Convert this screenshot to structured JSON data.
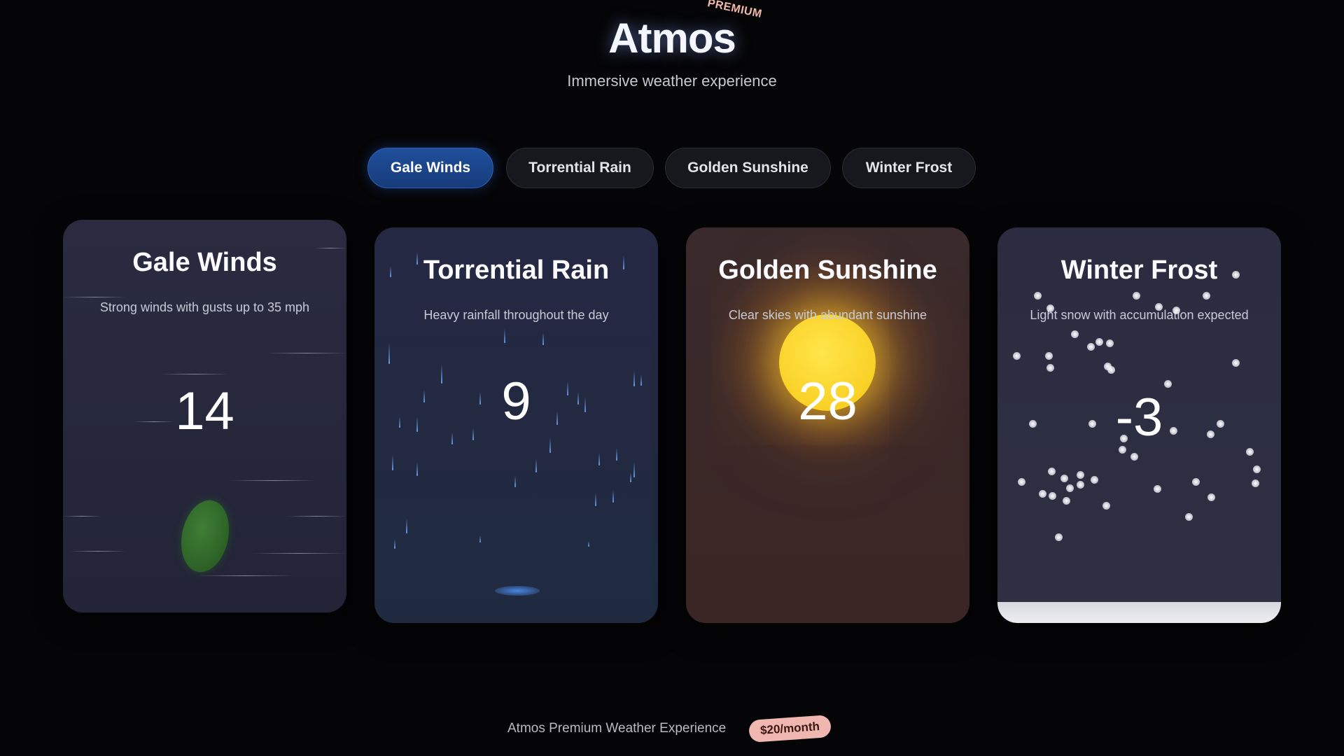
{
  "header": {
    "title": "Atmos",
    "premium_tag": "PREMIUM",
    "subtitle": "Immersive weather experience"
  },
  "tabs": [
    {
      "label": "Gale Winds",
      "active": true
    },
    {
      "label": "Torrential Rain",
      "active": false
    },
    {
      "label": "Golden Sunshine",
      "active": false
    },
    {
      "label": "Winter Frost",
      "active": false
    }
  ],
  "cards": {
    "wind": {
      "title": "Gale Winds",
      "description": "Strong winds with gusts up to 35 mph",
      "temperature": "14"
    },
    "rain": {
      "title": "Torrential Rain",
      "description": "Heavy rainfall throughout the day",
      "temperature": "9"
    },
    "sun": {
      "title": "Golden Sunshine",
      "description": "Clear skies with abundant sunshine",
      "temperature": "28"
    },
    "frost": {
      "title": "Winter Frost",
      "description": "Light snow with accumulation expected",
      "temperature": "-3"
    }
  },
  "footer": {
    "text": "Atmos Premium Weather Experience",
    "price": "$20/month"
  },
  "colors": {
    "background": "#050507",
    "active_tab": "#1f4f9c",
    "sun": "#ffe54a",
    "rain": "#6ea8ff",
    "leaf": "#2f6b2a",
    "price_badge": "#f0b6b0"
  },
  "icons": [
    "leaf-icon",
    "rain-drop-icon",
    "sun-icon",
    "snowflake-icon"
  ]
}
